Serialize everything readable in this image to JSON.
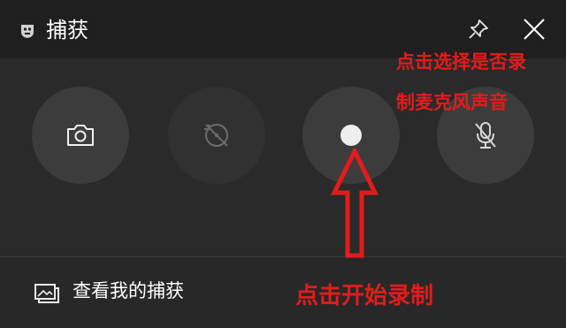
{
  "window": {
    "title": "捕获"
  },
  "footer": {
    "gallery_label": "查看我的捕获"
  },
  "annotations": {
    "mic_note_line1": "点击选择是否录",
    "mic_note_line2": "制麦克风声音",
    "record_note": "点击开始录制"
  },
  "icons": {
    "app": "capture-app-icon",
    "pin": "pin-icon",
    "close": "close-icon",
    "screenshot": "camera-icon",
    "record_last": "record-last-30s-icon",
    "record": "record-dot-icon",
    "mic": "microphone-off-icon",
    "gallery": "gallery-icon"
  },
  "colors": {
    "titlebar": "#1f1f1f",
    "panel": "#2a2a2a",
    "button": "#3c3c3c",
    "annotation": "#e41b1b",
    "text": "#ffffff"
  }
}
